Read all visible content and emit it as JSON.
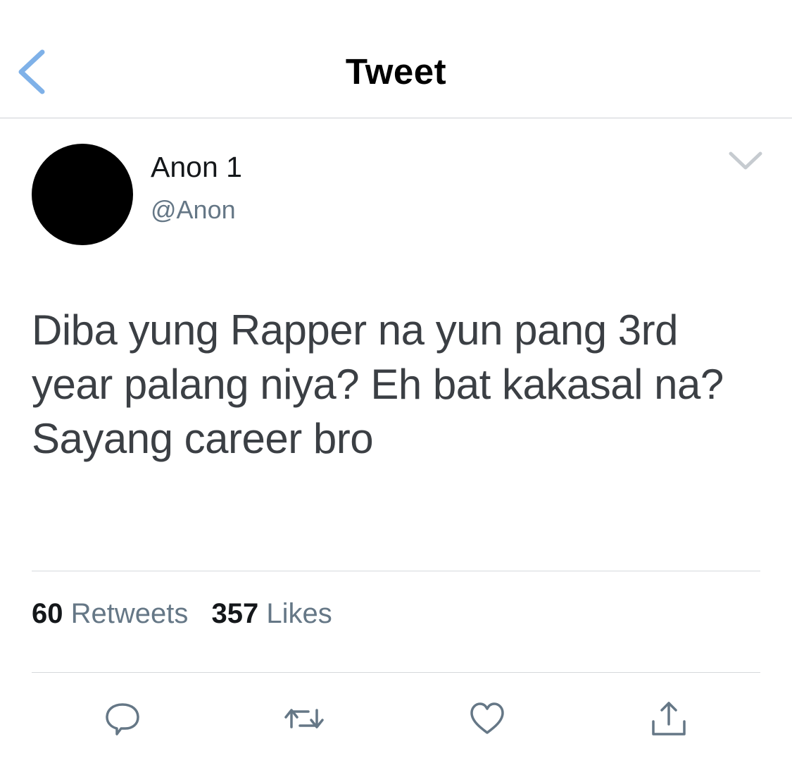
{
  "header": {
    "title": "Tweet",
    "back_icon": "chevron-left-icon",
    "accent_color": "#7fb1e8"
  },
  "tweet": {
    "author": {
      "display_name": "Anon 1",
      "handle": "@Anon"
    },
    "text_lines": [
      "Diba yung Rapper na yun pang 3rd",
      "year palang niya? Eh bat kakasal na?",
      "Sayang career bro"
    ],
    "menu_icon": "chevron-down-icon"
  },
  "stats": {
    "retweets": {
      "count": "60",
      "label": "Retweets"
    },
    "likes": {
      "count": "357",
      "label": "Likes"
    }
  },
  "actions": [
    {
      "icon": "reply-icon"
    },
    {
      "icon": "retweet-icon"
    },
    {
      "icon": "like-icon"
    },
    {
      "icon": "share-icon"
    }
  ]
}
